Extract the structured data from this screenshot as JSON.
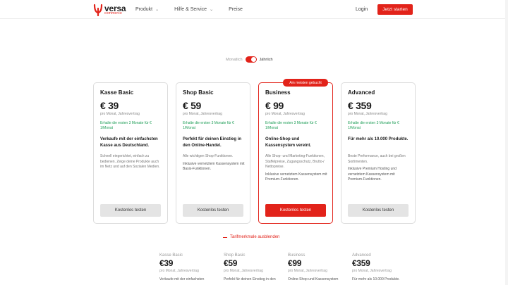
{
  "brand": {
    "word": "versa",
    "sub": "commerce",
    "accent": "#e2231a"
  },
  "nav": {
    "items": [
      {
        "label": "Produkt",
        "dropdown": true
      },
      {
        "label": "Hilfe & Service",
        "dropdown": true
      },
      {
        "label": "Preise",
        "dropdown": false
      }
    ],
    "login": "Login",
    "cta": "Jetzt starten"
  },
  "billing": {
    "monthly": "Monatlich",
    "yearly": "Jährlich",
    "yearly_selected": true
  },
  "plans": [
    {
      "name": "Kasse Basic",
      "price": "€ 39",
      "note": "pro Monat, Jahresvertrag",
      "promo": "Erhalte die ersten 3 Monate für € 1/Monat",
      "headline": "Verkaufe mit der einfachsten Kasse aus Deutschland.",
      "desc": "Schnell eingerichtet, einfach zu bedienen. Zeige deine Produkte auch im Netz und auf den Sozialen Medien.",
      "desc2": "",
      "button": "Kostenlos testen"
    },
    {
      "name": "Shop Basic",
      "price": "€ 59",
      "note": "pro Monat, Jahresvertrag",
      "promo": "Erhalte die ersten 3 Monate für € 1/Monat",
      "headline": "Perfekt für deinen Einstieg in den Online-Handel.",
      "desc": "Alle wichtigen Shop-Funktionen.",
      "desc2": "Inklusive vernetztem Kassensystem mit Basis-Funktionen.",
      "button": "Kostenlos testen"
    },
    {
      "name": "Business",
      "price": "€ 99",
      "note": "pro Monat, Jahresvertrag",
      "promo": "Erhalte die ersten 3 Monate für € 1/Monat",
      "headline": "Online-Shop und Kassensystem vereint.",
      "desc": "Alle Shop- und Marketing-Funktionen, Staffelpreise, Zugangsschutz, Brutto-/ Nettopreise.",
      "desc2": "Inklusive vernetztem Kassensystem mit Premium-Funktionen.",
      "button": "Kostenlos testen",
      "badge": "Am meisten gebucht"
    },
    {
      "name": "Advanced",
      "price": "€ 359",
      "note": "pro Monat, Jahresvertrag",
      "promo": "Erhalte die ersten 3 Monate für € 1/Monat",
      "headline": "Für mehr als 10.000 Produkte.",
      "desc": "Beste Performance, auch bei großen Sortimenten.",
      "desc2": "Inklusive Premium Hosting und vernetztem Kassensystem mit Premium-Funktionen.",
      "button": "Kostenlos testen"
    }
  ],
  "features_toggle": "Tarifmerkmale ausblenden",
  "comparison": [
    {
      "name": "Kasse Basic",
      "price": "€39",
      "note": "pro Monat, Jahresvertrag",
      "head": "Verkaufe mit der einfachsten"
    },
    {
      "name": "Shop Basic",
      "price": "€59",
      "note": "pro Monat, Jahresvertrag",
      "head": "Perfekt für deinen Einstieg in den"
    },
    {
      "name": "Business",
      "price": "€99",
      "note": "pro Monat, Jahresvertrag",
      "head": "Online-Shop und Kassensystem"
    },
    {
      "name": "Advanced",
      "price": "€359",
      "note": "pro Monat, Jahresvertrag",
      "head": "Für mehr als 10.000 Produkte."
    }
  ]
}
